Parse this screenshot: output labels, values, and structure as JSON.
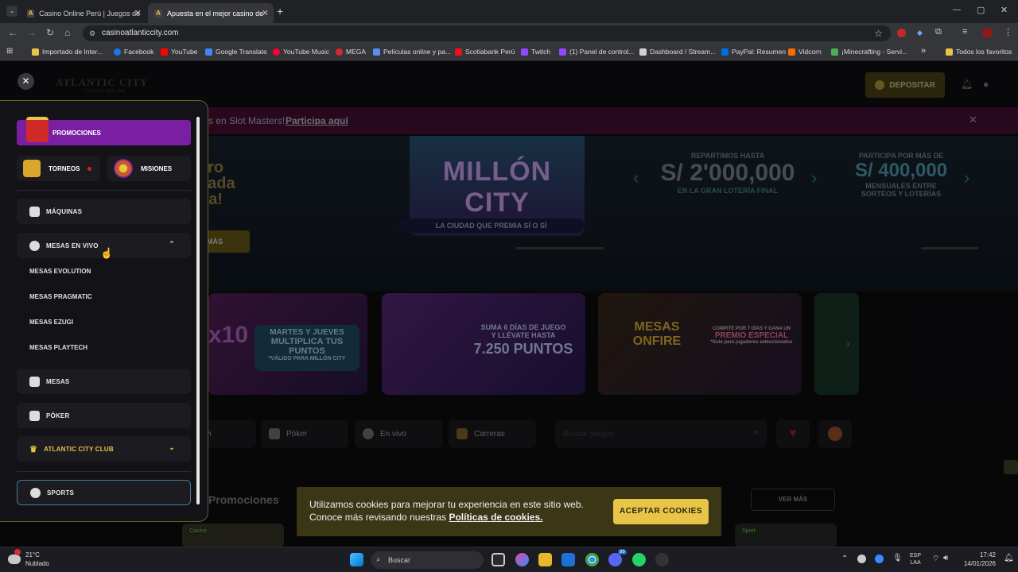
{
  "browser": {
    "tabs": [
      {
        "title": "Casino Online Perú | Juegos de",
        "favicon": "A",
        "active": false
      },
      {
        "title": "Apuesta en el mejor casino de",
        "favicon": "A",
        "active": true
      }
    ],
    "new_tab": "+",
    "url": "casinoatlanticcity.com",
    "window_controls": {
      "minimize": "—",
      "maximize": "▢",
      "close": "✕"
    }
  },
  "bookmarks": [
    {
      "label": "Importado de Inter...",
      "color": "#e8c547"
    },
    {
      "label": "Facebook",
      "color": "#1877f2"
    },
    {
      "label": "YouTube",
      "color": "#ff0000"
    },
    {
      "label": "Google Translate",
      "color": "#4285f4"
    },
    {
      "label": "YouTube Music",
      "color": "#ff0033"
    },
    {
      "label": "MEGA",
      "color": "#d9272e"
    },
    {
      "label": "Películas online y pa...",
      "color": "#5b8def"
    },
    {
      "label": "Scotiabank Perú",
      "color": "#ec111a"
    },
    {
      "label": "Twitch",
      "color": "#9146ff"
    },
    {
      "label": "(1) Panel de control...",
      "color": "#9146ff"
    },
    {
      "label": "Dashboard / Stream...",
      "color": "#e0e0e0"
    },
    {
      "label": "PayPal: Resumen",
      "color": "#0070e0"
    },
    {
      "label": "Vidcorn",
      "color": "#ff6a00"
    },
    {
      "label": "¡Minecrafting - Servi...",
      "color": "#4caf50"
    },
    {
      "label": "»",
      "color": ""
    },
    {
      "label": "Todos los favoritos",
      "color": "#e8c547"
    }
  ],
  "site": {
    "logo": "ATLANTIC CITY",
    "logo_sub": "CASINO ONLINE",
    "deposit_label": "DEPOSITAR",
    "promo_strip_text": "s en Slot Masters!",
    "promo_strip_link": "Participa aquí",
    "hero": {
      "left_text": "ero",
      "left_text2": "cada",
      "left_text3": "ha!",
      "left_button": "MÁS",
      "center_title": "MILLÓN CITY",
      "center_tagline": "LA CIUDAD QUE PREMIA SÍ O SÍ",
      "right1_top": "REPARTIMOS HASTA",
      "right1_amount": "S/ 2'000,000",
      "right1_bottom": "EN LA GRAN LOTERÍA FINAL",
      "right2_top": "PARTICIPA POR MÁS DE",
      "right2_amount": "S/ 400,000",
      "right2_bottom1": "MENSUALES ENTRE",
      "right2_bottom2": "SORTEOS Y LOTERÍAS"
    },
    "cards": [
      {
        "line1": "MARTES Y JUEVES",
        "line2": "MULTIPLICA TUS",
        "line3": "PUNTOS",
        "line4": "*VÁLIDO PARA MILLÓN CITY",
        "badge": "x10"
      },
      {
        "line1": "SUMA 6 DÍAS DE JUEGO",
        "line2": "Y LLÉVATE HASTA",
        "line3": "7.250 PUNTOS"
      },
      {
        "line1": "MESAS",
        "line2": "ONFIRE",
        "line3": "COMPITE POR 7 DÍAS Y GANA UN",
        "line4": "PREMIO ESPECIAL",
        "line5": "*Solo para jugadores seleccionados"
      }
    ],
    "chips": [
      "h",
      "Póker",
      "En vivo",
      "Carreras"
    ],
    "search_placeholder": "Buscar juegos",
    "section_title": "Promociones",
    "see_more": "VER MÁS",
    "casino_tag": "Casino",
    "sport_tag": "Sport",
    "cookies": {
      "line1": "Utilizamos cookies para mejorar tu experiencia en este sitio web.",
      "line2": "Conoce más revisando nuestras",
      "link": "Políticas de cookies.",
      "accept": "ACEPTAR COOKIES"
    }
  },
  "menu": {
    "close": "✕",
    "promociones": "PROMOCIONES",
    "torneos": "TORNEOS",
    "misiones": "MISIONES",
    "maquinas": "MÁQUINAS",
    "mesas_en_vivo": "MESAS EN VIVO",
    "sub": [
      "MESAS EVOLUTION",
      "MESAS PRAGMATIC",
      "MESAS EZUGI",
      "MESAS PLAYTECH"
    ],
    "mesas": "MESAS",
    "poker": "PÓKER",
    "club": "ATLANTIC CITY CLUB",
    "sports": "SPORTS"
  },
  "taskbar": {
    "weather_temp": "21°C",
    "weather_desc": "Nublado",
    "search": "Buscar",
    "lang1": "ESP",
    "lang2": "LAA",
    "time": "17:42",
    "date": "14/01/2026",
    "badge_count": "99"
  },
  "colors": {
    "gold": "#e8c547",
    "purple": "#7a1fa2",
    "strip": "#4a0f37"
  }
}
